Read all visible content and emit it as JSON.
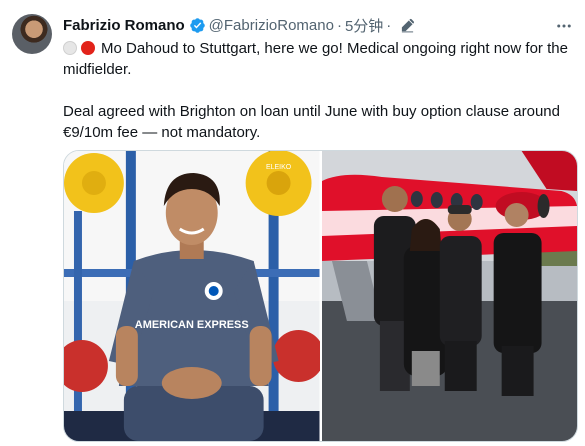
{
  "author": {
    "name": "Fabrizio Romano",
    "handle": "@FabrizioRomano",
    "separator": "·",
    "time": "5分钟"
  },
  "icons": {
    "avatar": "profile-photo",
    "verified": "verified-badge-icon",
    "edit": "edited-pencil-icon",
    "more": "more-options-icon",
    "flags": [
      "white-circle-emoji",
      "red-circle-emoji"
    ]
  },
  "tweet": {
    "line1": "Mo Dahoud to Stuttgart, here we go! Medical ongoing right now for the midfielder.",
    "line2": "Deal agreed with Brighton on loan until June with buy option clause around €9/10m fee — not mandatory."
  },
  "media": {
    "photo1_shirt_sponsor": "AMERICAN EXPRESS",
    "photo1_plate_lettering": "ELEIKO",
    "count": 2
  },
  "colors": {
    "verified": "#1d9bf0",
    "text": "#0f1419",
    "muted": "#536471",
    "border": "#cfd9de",
    "jet_red": "#e0102a",
    "kit_blue": "#4e5f7d"
  }
}
